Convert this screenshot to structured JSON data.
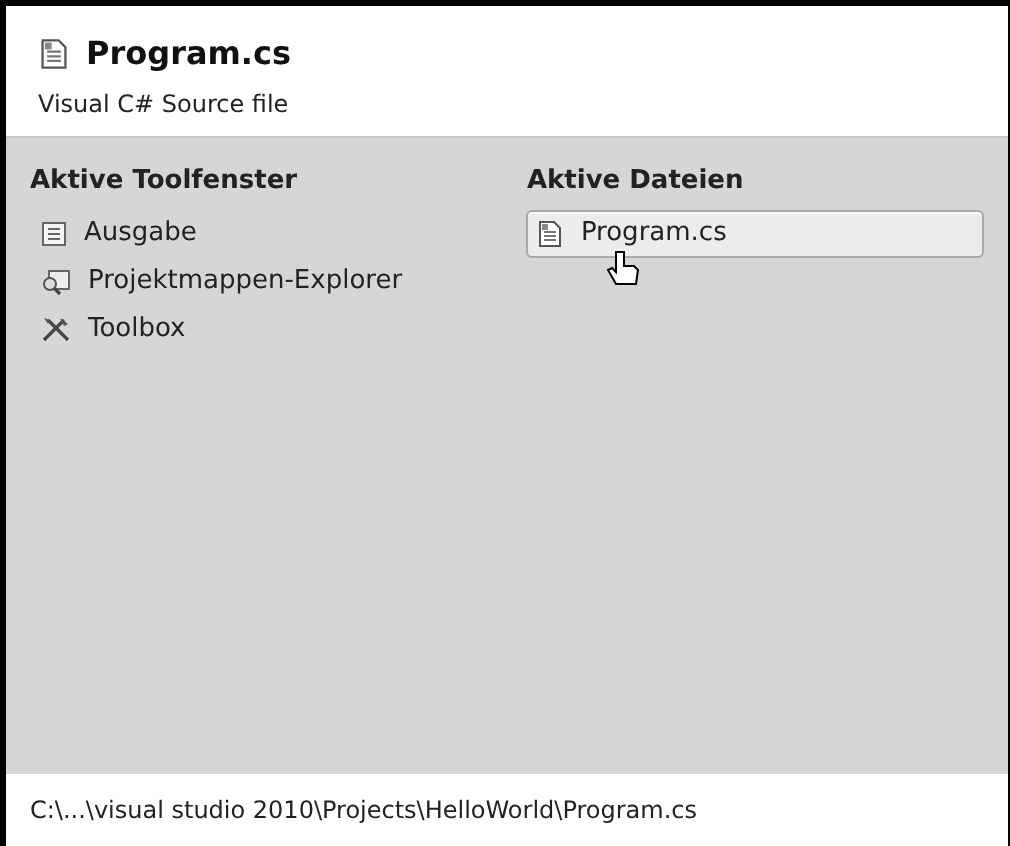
{
  "header": {
    "title": "Program.cs",
    "subtitle": "Visual C# Source file"
  },
  "tool_windows": {
    "heading": "Aktive Toolfenster",
    "items": [
      {
        "label": "Ausgabe",
        "kind": "output",
        "selected": false
      },
      {
        "label": "Projektmappen-Explorer",
        "kind": "explorer",
        "selected": false
      },
      {
        "label": "Toolbox",
        "kind": "toolbox",
        "selected": false
      }
    ]
  },
  "active_files": {
    "heading": "Aktive Dateien",
    "items": [
      {
        "label": "Program.cs",
        "kind": "file",
        "selected": true
      }
    ]
  },
  "status_bar": {
    "path": "C:\\...\\visual studio 2010\\Projects\\HelloWorld\\Program.cs"
  }
}
